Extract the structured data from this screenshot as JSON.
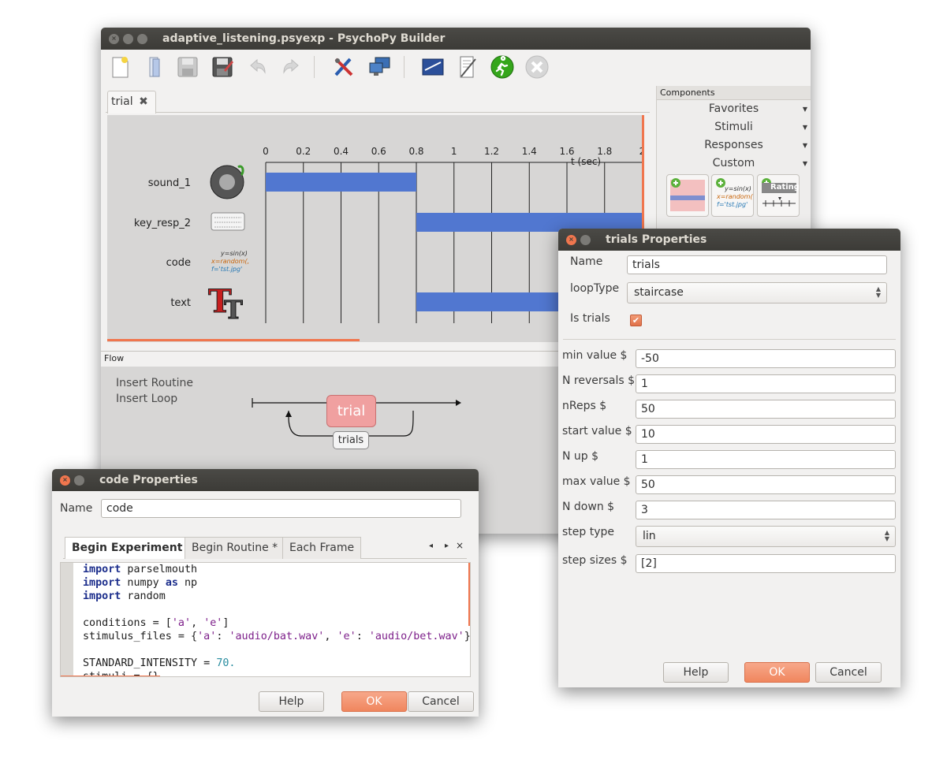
{
  "main_window": {
    "title": "adaptive_listening.psyexp - PsychoPy Builder",
    "tab_label": "trial",
    "routine": {
      "time_label": "t (sec)",
      "ticks": [
        "0",
        "0.2",
        "0.4",
        "0.6",
        "0.8",
        "1",
        "1.2",
        "1.4",
        "1.6",
        "1.8",
        "2"
      ],
      "components": [
        {
          "name": "sound_1",
          "icon": "speaker-icon",
          "start": 0,
          "stop": 1
        },
        {
          "name": "key_resp_2",
          "icon": "keyboard-icon",
          "start": 1,
          "stop": null
        },
        {
          "name": "code",
          "icon": "code-icon",
          "start": null,
          "stop": null
        },
        {
          "name": "text",
          "icon": "text-icon",
          "start": 1,
          "stop": null
        }
      ],
      "code_icon_lines": [
        "y=sin(x)",
        "x=random(,",
        "f='tst.jpg'"
      ],
      "text_icon_letters": "TT"
    },
    "flow": {
      "label": "Flow",
      "insert_routine": "Insert Routine",
      "insert_loop": "Insert Loop",
      "routine_name": "trial",
      "loop_name": "trials"
    },
    "components_panel": {
      "title": "Components",
      "categories": [
        "Favorites",
        "Stimuli",
        "Responses",
        "Custom"
      ],
      "rating_label": "Rating"
    },
    "colors": {
      "accent": "#f0764e",
      "bar": "#5177d0",
      "routine_box": "#f0a0a0"
    }
  },
  "trials_dialog": {
    "title": "trials Properties",
    "name_label": "Name",
    "name_value": "trials",
    "looptype_label": "loopType",
    "looptype_value": "staircase",
    "istrials_label": "Is trials",
    "istrials_checked": true,
    "fields": [
      {
        "label": "min value $",
        "value": "-50"
      },
      {
        "label": "N reversals $",
        "value": "1"
      },
      {
        "label": "nReps $",
        "value": "50"
      },
      {
        "label": "start value $",
        "value": "10"
      },
      {
        "label": "N up $",
        "value": "1"
      },
      {
        "label": "max value $",
        "value": "50"
      },
      {
        "label": "N down $",
        "value": "3"
      }
    ],
    "steptype_label": "step type",
    "steptype_value": "lin",
    "stepsizes_label": "step sizes $",
    "stepsizes_value": "[2]",
    "help": "Help",
    "ok": "OK",
    "cancel": "Cancel"
  },
  "code_dialog": {
    "title": "code Properties",
    "name_label": "Name",
    "name_value": "code",
    "tabs": [
      "Begin Experiment *",
      "Begin Routine *",
      "Each Frame"
    ],
    "help": "Help",
    "ok": "OK",
    "cancel": "Cancel"
  }
}
